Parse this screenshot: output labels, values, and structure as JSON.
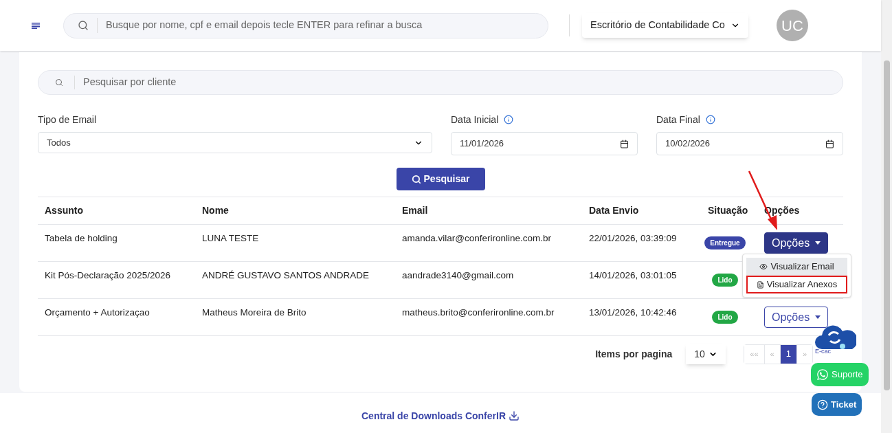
{
  "header": {
    "search_placeholder": "Busque por nome, cpf e email depois tecle ENTER para refinar a busca",
    "office": "Escritório de Contabilidade Co",
    "avatar": "UC"
  },
  "filters": {
    "client_placeholder": "Pesquisar por cliente",
    "email_type": {
      "label": "Tipo de Email",
      "value": "Todos"
    },
    "start_date": {
      "label": "Data Inicial",
      "value": "11/01/2026"
    },
    "end_date": {
      "label": "Data Final",
      "value": "10/02/2026"
    },
    "search_button": "Pesquisar"
  },
  "table": {
    "columns": [
      "Assunto",
      "Nome",
      "Email",
      "Data Envio",
      "Situação",
      "Opções"
    ],
    "rows": [
      {
        "subject": "Tabela de holding",
        "name": "LUNA TESTE",
        "email": "amanda.vilar@conferironline.com.br",
        "sent": "22/01/2026, 03:39:09",
        "status": "Entregue",
        "color": "#3a45a8",
        "options": "Opções",
        "options_open": true
      },
      {
        "subject": "Kit Pós-Declaração 2025/2026",
        "name": "ANDRÉ GUSTAVO SANTOS ANDRADE",
        "email": "aandrade3140@gmail.com",
        "sent": "14/01/2026, 03:01:05",
        "status": "Lido",
        "color": "#22a745"
      },
      {
        "subject": "Orçamento + Autorizaçao",
        "name": "Matheus Moreira de Brito",
        "email": "matheus.brito@conferironline.com.br",
        "sent": "13/01/2026, 10:42:46",
        "status": "Lido",
        "color": "#22a745",
        "options": "Opções",
        "options_open": false
      }
    ]
  },
  "options_menu": [
    {
      "label": "Visualizar Email",
      "kind": "eye",
      "selected": true,
      "annotated": false
    },
    {
      "label": "Visualizar Anexos",
      "kind": "file",
      "selected": false,
      "annotated": true
    }
  ],
  "pagination": {
    "label": "Items por pagina",
    "page_size": "10",
    "pages": [
      {
        "label": "««",
        "selected": false
      },
      {
        "label": "«",
        "selected": false
      },
      {
        "label": "1",
        "selected": true
      },
      {
        "label": "»",
        "selected": false
      }
    ]
  },
  "floating": {
    "ecac": "E-cac",
    "support": "Suporte",
    "ticket": "Ticket"
  },
  "footer": {
    "link": "Central de Downloads ConferIR"
  }
}
